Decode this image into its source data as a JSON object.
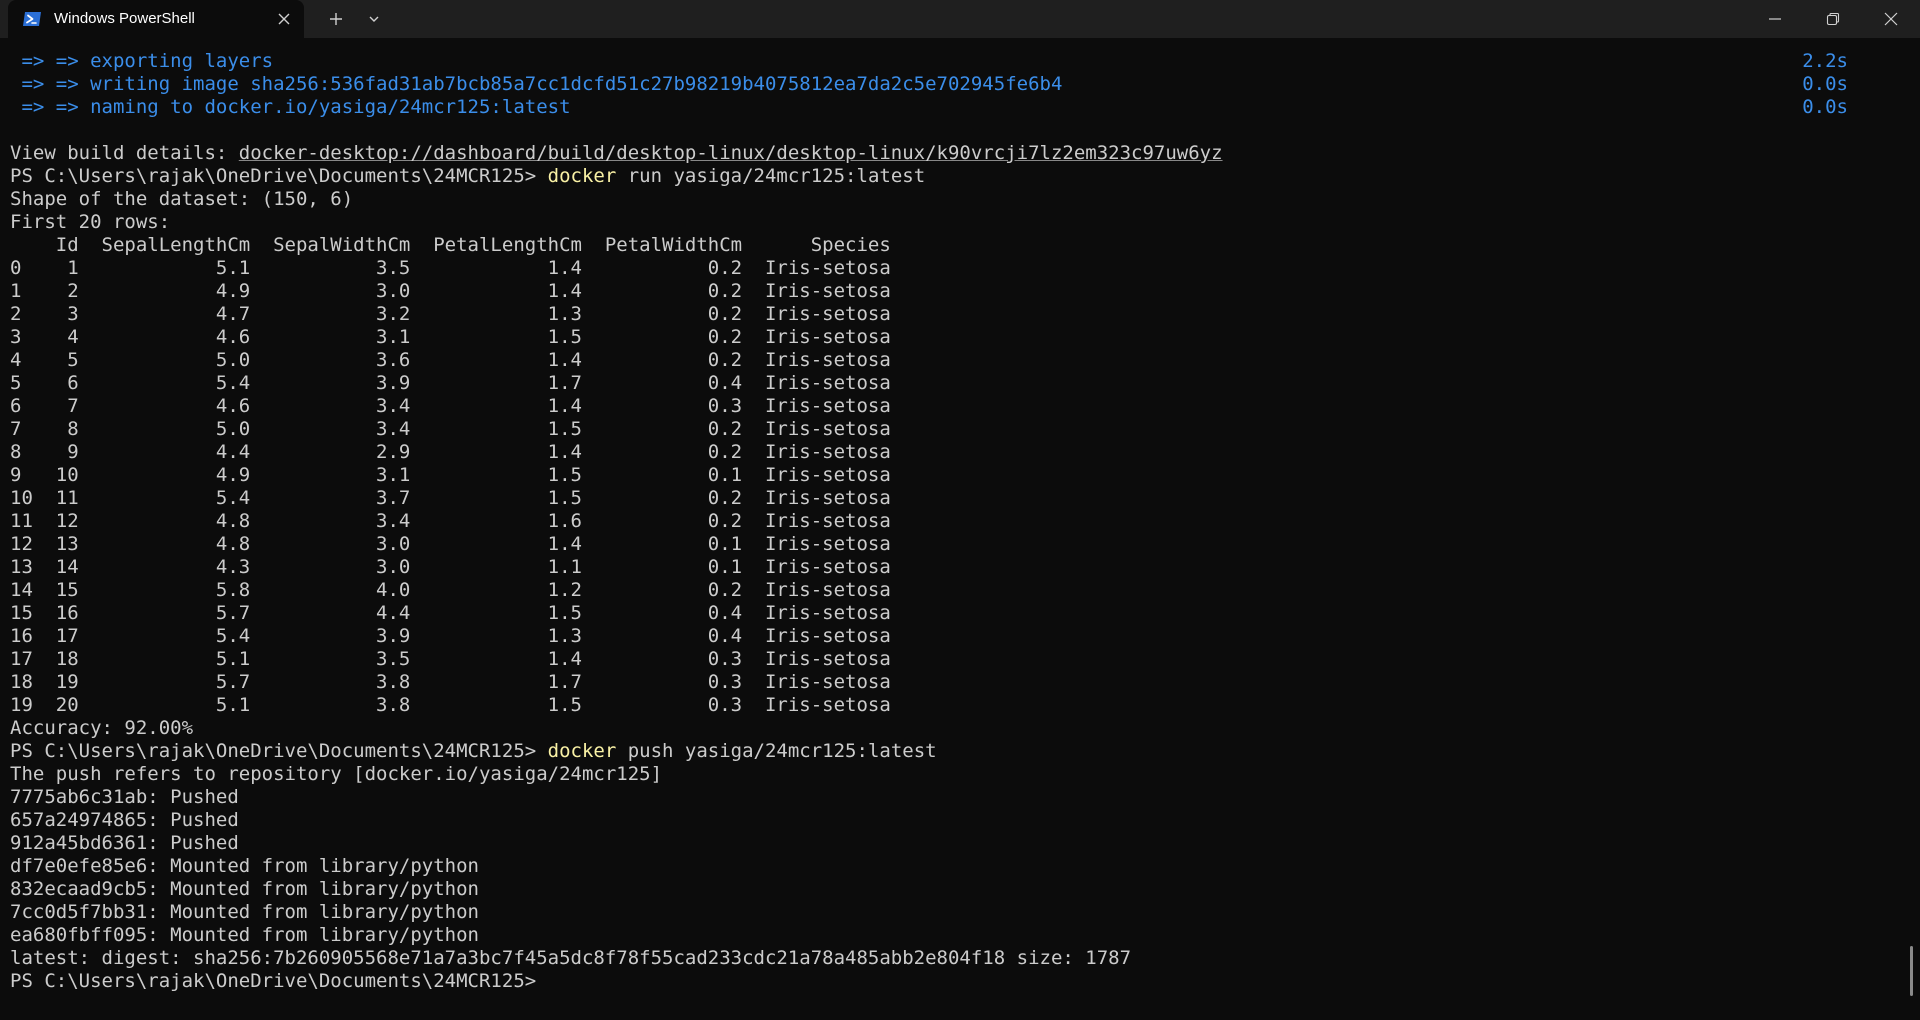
{
  "window": {
    "tab_title": "Windows PowerShell",
    "icons": {
      "tab": "powershell-icon",
      "close_tab": "close-icon",
      "new_tab": "plus-icon",
      "dropdown": "chevron-down-icon",
      "minimize": "minimize-icon",
      "maximize": "restore-icon",
      "close_window": "close-icon"
    }
  },
  "colors": {
    "background": "#0c0c0c",
    "titlebar": "#1f1f1f",
    "text": "#cccccc",
    "blue": "#3b8eea",
    "command": "#f9f1a5"
  },
  "terminal": {
    "build_steps": [
      {
        "text": " => => exporting layers",
        "time": "2.2s"
      },
      {
        "text": " => => writing image sha256:536fad31ab7bcb85a7cc1dcfd51c27b98219b4075812ea7da2c5e702945fe6b4",
        "time": "0.0s"
      },
      {
        "text": " => => naming to docker.io/yasiga/24mcr125:latest",
        "time": "0.0s"
      }
    ],
    "build_details_label": "View build details: ",
    "build_details_url": "docker-desktop://dashboard/build/desktop-linux/desktop-linux/k90vrcji7lz2em323c97uw6yz",
    "prompt": "PS C:\\Users\\rajak\\OneDrive\\Documents\\24MCR125> ",
    "command1_name": "docker",
    "command1_args": " run yasiga/24mcr125:latest",
    "shape_line": "Shape of the dataset: (150, 6)",
    "first_rows_line": "First 20 rows:",
    "table": {
      "header": "    Id  SepalLengthCm  SepalWidthCm  PetalLengthCm  PetalWidthCm      Species",
      "rows": [
        "0    1            5.1           3.5            1.4           0.2  Iris-setosa",
        "1    2            4.9           3.0            1.4           0.2  Iris-setosa",
        "2    3            4.7           3.2            1.3           0.2  Iris-setosa",
        "3    4            4.6           3.1            1.5           0.2  Iris-setosa",
        "4    5            5.0           3.6            1.4           0.2  Iris-setosa",
        "5    6            5.4           3.9            1.7           0.4  Iris-setosa",
        "6    7            4.6           3.4            1.4           0.3  Iris-setosa",
        "7    8            5.0           3.4            1.5           0.2  Iris-setosa",
        "8    9            4.4           2.9            1.4           0.2  Iris-setosa",
        "9   10            4.9           3.1            1.5           0.1  Iris-setosa",
        "10  11            5.4           3.7            1.5           0.2  Iris-setosa",
        "11  12            4.8           3.4            1.6           0.2  Iris-setosa",
        "12  13            4.8           3.0            1.4           0.1  Iris-setosa",
        "13  14            4.3           3.0            1.1           0.1  Iris-setosa",
        "14  15            5.8           4.0            1.2           0.2  Iris-setosa",
        "15  16            5.7           4.4            1.5           0.4  Iris-setosa",
        "16  17            5.4           3.9            1.3           0.4  Iris-setosa",
        "17  18            5.1           3.5            1.4           0.3  Iris-setosa",
        "18  19            5.7           3.8            1.7           0.3  Iris-setosa",
        "19  20            5.1           3.8            1.5           0.3  Iris-setosa"
      ]
    },
    "accuracy_line": "Accuracy: 92.00%",
    "command2_name": "docker",
    "command2_args": " push yasiga/24mcr125:latest",
    "push_lines": [
      "The push refers to repository [docker.io/yasiga/24mcr125]",
      "7775ab6c31ab: Pushed",
      "657a24974865: Pushed",
      "912a45bd6361: Pushed",
      "df7e0efe85e6: Mounted from library/python",
      "832ecaad9cb5: Mounted from library/python",
      "7cc0d5f7bb31: Mounted from library/python",
      "ea680fbff095: Mounted from library/python",
      "latest: digest: sha256:7b260905568e71a7a3bc7f45a5dc8f78f55cad233cdc21a78a485abb2e804f18 size: 1787"
    ]
  }
}
